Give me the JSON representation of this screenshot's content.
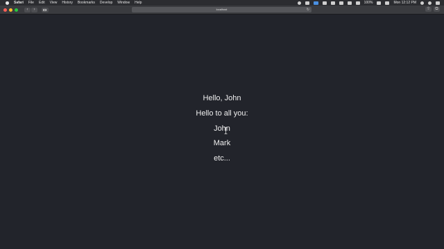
{
  "menubar": {
    "app_name": "Safari",
    "menus": [
      "File",
      "Edit",
      "View",
      "History",
      "Bookmarks",
      "Develop",
      "Window",
      "Help"
    ],
    "battery": "100%",
    "clock": "Mon 12:12 PM"
  },
  "toolbar": {
    "address": "localhost",
    "back_icon": "chevron-left",
    "forward_icon": "chevron-right"
  },
  "page": {
    "lines": [
      "Hello, John",
      "Hello to all you:",
      "John",
      "Mark",
      "etc..."
    ]
  }
}
